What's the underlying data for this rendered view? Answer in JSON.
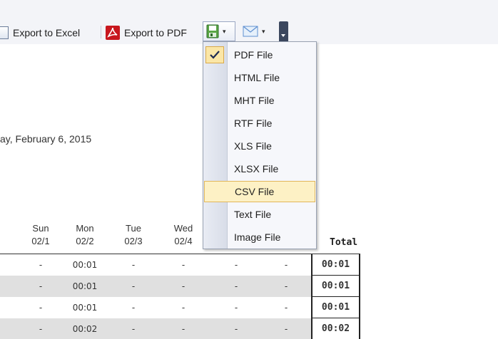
{
  "toolbar": {
    "export_excel_label": "Export to Excel",
    "export_pdf_label": "Export to PDF",
    "save_icon": "save-disk-icon",
    "mail_icon": "envelope-icon",
    "caret": "▾"
  },
  "report": {
    "date_line": "ay, February 6, 2015",
    "columns": [
      {
        "day": "Sun",
        "date": "02/1"
      },
      {
        "day": "Mon",
        "date": "02/2"
      },
      {
        "day": "Tue",
        "date": "02/3"
      },
      {
        "day": "Wed",
        "date": "02/4"
      }
    ],
    "total_header": "Total",
    "rows": [
      {
        "cells": [
          "-",
          "00:01",
          "-",
          "-",
          "-",
          "-"
        ],
        "total": "00:01"
      },
      {
        "cells": [
          "-",
          "00:01",
          "-",
          "-",
          "-",
          "-"
        ],
        "total": "00:01"
      },
      {
        "cells": [
          "-",
          "00:01",
          "-",
          "-",
          "-",
          "-"
        ],
        "total": "00:01"
      },
      {
        "cells": [
          "-",
          "00:02",
          "-",
          "-",
          "-",
          "-"
        ],
        "total": "00:02"
      }
    ]
  },
  "export_menu": {
    "items": [
      "PDF File",
      "HTML File",
      "MHT File",
      "RTF File",
      "XLS File",
      "XLSX File",
      "CSV File",
      "Text File",
      "Image File"
    ],
    "checked": "PDF File",
    "highlighted": "CSV File"
  },
  "colors": {
    "toolbar_bg": "#f3f4f8",
    "menu_highlight": "#fdf1c5",
    "menu_highlight_border": "#e1b659",
    "row_shade": "#e0e0e0",
    "pdf_red": "#c8171e"
  }
}
